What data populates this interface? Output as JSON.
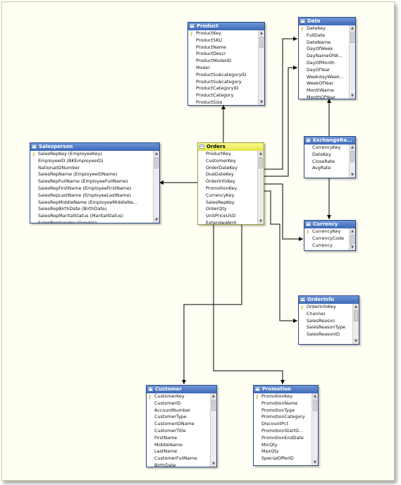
{
  "tables": [
    {
      "id": "product",
      "title": "Product",
      "rows": [
        {
          "label": "ProductKey",
          "key": true
        },
        {
          "label": "ProductSKU"
        },
        {
          "label": "ProductName"
        },
        {
          "label": "ProductDescr"
        },
        {
          "label": "ProductModelID"
        },
        {
          "label": "Model"
        },
        {
          "label": "ProductSubcategoryID"
        },
        {
          "label": "ProductSubcategory"
        },
        {
          "label": "ProductCategoryID"
        },
        {
          "label": "ProductCategory"
        },
        {
          "label": "ProductSize"
        }
      ]
    },
    {
      "id": "date",
      "title": "Date",
      "rows": [
        {
          "label": "DateKey",
          "key": true
        },
        {
          "label": "FullDate"
        },
        {
          "label": "DateName"
        },
        {
          "label": "DayOfWeek"
        },
        {
          "label": "DayNameOfW..."
        },
        {
          "label": "DayOfMonth"
        },
        {
          "label": "DayOfYear"
        },
        {
          "label": "WeekdayWeek..."
        },
        {
          "label": "WeekOfYear"
        },
        {
          "label": "MonthName"
        },
        {
          "label": "MonthOfYear"
        }
      ]
    },
    {
      "id": "salesperson",
      "title": "Salesperson",
      "rows": [
        {
          "label": "SalesRepKey (EmployeeKey)",
          "key": true
        },
        {
          "label": "EmployeeID (BKEmployeeID)"
        },
        {
          "label": "NationalIDNumber"
        },
        {
          "label": "SalesRepName (EmployeeIDName)"
        },
        {
          "label": "SalesRepFullName (EmployeeFullName)"
        },
        {
          "label": "SalesRepFirstName (EmployeeFirstName)"
        },
        {
          "label": "SalesRepLastName (EmployeeLastName)"
        },
        {
          "label": "SalesRepMiddleName (EmployeeMiddleNa..."
        },
        {
          "label": "SalesRepBirthDate (BirthDate)"
        },
        {
          "label": "SalesRepMaritalStatus (MaritalStatus)"
        },
        {
          "label": "SalesRepGender (Gender)"
        }
      ]
    },
    {
      "id": "orders",
      "title": "Orders",
      "fact": true,
      "rows": [
        {
          "label": "ProductKey"
        },
        {
          "label": "CustomerKey"
        },
        {
          "label": "OrderDateKey"
        },
        {
          "label": "DueDateKey"
        },
        {
          "label": "OrderInfoKey"
        },
        {
          "label": "PromotionKey"
        },
        {
          "label": "CurrencyKey"
        },
        {
          "label": "SalesRepKey"
        },
        {
          "label": "OrderQty"
        },
        {
          "label": "UnitPriceUSD"
        },
        {
          "label": "ExtendedAmt"
        }
      ]
    },
    {
      "id": "exchangerate",
      "title": "ExchangeRa...",
      "rows": [
        {
          "label": "CurrencyKey"
        },
        {
          "label": "DateKey"
        },
        {
          "label": "CloseRate"
        },
        {
          "label": "AvgRate"
        }
      ]
    },
    {
      "id": "currency",
      "title": "Currency",
      "rows": [
        {
          "label": "CurrencyKey",
          "key": true
        },
        {
          "label": "CurrencyCode"
        },
        {
          "label": "Currency"
        }
      ]
    },
    {
      "id": "orderinfo",
      "title": "OrderInfo",
      "rows": [
        {
          "label": "OrderInfoKey",
          "key": true
        },
        {
          "label": "Channel"
        },
        {
          "label": "SalesReason"
        },
        {
          "label": "SalesReasonType"
        },
        {
          "label": "SalesReasonID"
        }
      ]
    },
    {
      "id": "customer",
      "title": "Customer",
      "rows": [
        {
          "label": "CustomerKey",
          "key": true
        },
        {
          "label": "CustomerID"
        },
        {
          "label": "AccountNumber"
        },
        {
          "label": "CustomerType"
        },
        {
          "label": "CustomerIDName"
        },
        {
          "label": "CustomerTitle"
        },
        {
          "label": "FirstName"
        },
        {
          "label": "MiddleName"
        },
        {
          "label": "LastName"
        },
        {
          "label": "CustomerFullName"
        },
        {
          "label": "BirthDate"
        }
      ]
    },
    {
      "id": "promotion",
      "title": "Promotion",
      "rows": [
        {
          "label": "PromotionKey",
          "key": true
        },
        {
          "label": "PromotionName"
        },
        {
          "label": "PromotionType"
        },
        {
          "label": "PromotionCategory"
        },
        {
          "label": "DiscountPct"
        },
        {
          "label": "PromotionStartD..."
        },
        {
          "label": "PromotionEndDate"
        },
        {
          "label": "MinQty"
        },
        {
          "label": "MaxQty"
        },
        {
          "label": "SpecialOfferID"
        }
      ]
    }
  ],
  "relationships": [
    {
      "from": "orders",
      "to": "product"
    },
    {
      "from": "orders",
      "to": "date"
    },
    {
      "from": "orders",
      "to": "date"
    },
    {
      "from": "orders",
      "to": "salesperson"
    },
    {
      "from": "orders",
      "to": "currency"
    },
    {
      "from": "orders",
      "to": "orderinfo"
    },
    {
      "from": "orders",
      "to": "customer"
    },
    {
      "from": "orders",
      "to": "promotion"
    },
    {
      "from": "exchangerate",
      "to": "date"
    },
    {
      "from": "exchangerate",
      "to": "currency"
    }
  ],
  "colors": {
    "line": "#000000",
    "dimension_header": "#4a73bf",
    "fact_header": "#f0f070",
    "key_icon": "#d4a000"
  }
}
